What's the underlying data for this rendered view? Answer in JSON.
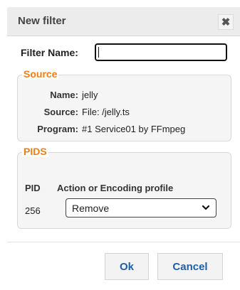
{
  "dialog": {
    "title": "New filter",
    "close_symbol": "✖"
  },
  "filter_name": {
    "label": "Filter Name:",
    "value": ""
  },
  "source": {
    "legend": "Source",
    "rows": [
      {
        "key": "Name:",
        "value": "jelly"
      },
      {
        "key": "Source:",
        "value": "File: /jelly.ts"
      },
      {
        "key": "Program:",
        "value": "#1 Service01 by FFmpeg"
      }
    ]
  },
  "pids": {
    "legend": "PIDS",
    "col_pid": "PID",
    "col_action": "Action or Encoding profile",
    "rows": [
      {
        "pid": "256",
        "action": "Remove"
      }
    ]
  },
  "buttons": {
    "ok": "Ok",
    "cancel": "Cancel"
  },
  "colors": {
    "legend": "#ef7e12",
    "button_text": "#1f5fa8"
  },
  "icons": {
    "close": "close-icon",
    "dropdown": "chevron-down-icon"
  }
}
